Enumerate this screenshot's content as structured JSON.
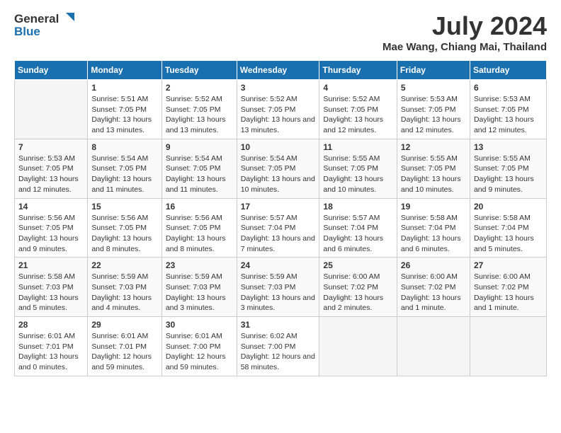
{
  "header": {
    "logo_general": "General",
    "logo_blue": "Blue",
    "month_year": "July 2024",
    "location": "Mae Wang, Chiang Mai, Thailand"
  },
  "calendar": {
    "weekdays": [
      "Sunday",
      "Monday",
      "Tuesday",
      "Wednesday",
      "Thursday",
      "Friday",
      "Saturday"
    ],
    "weeks": [
      [
        {
          "day": "",
          "sunrise": "",
          "sunset": "",
          "daylight": ""
        },
        {
          "day": "1",
          "sunrise": "Sunrise: 5:51 AM",
          "sunset": "Sunset: 7:05 PM",
          "daylight": "Daylight: 13 hours and 13 minutes."
        },
        {
          "day": "2",
          "sunrise": "Sunrise: 5:52 AM",
          "sunset": "Sunset: 7:05 PM",
          "daylight": "Daylight: 13 hours and 13 minutes."
        },
        {
          "day": "3",
          "sunrise": "Sunrise: 5:52 AM",
          "sunset": "Sunset: 7:05 PM",
          "daylight": "Daylight: 13 hours and 13 minutes."
        },
        {
          "day": "4",
          "sunrise": "Sunrise: 5:52 AM",
          "sunset": "Sunset: 7:05 PM",
          "daylight": "Daylight: 13 hours and 12 minutes."
        },
        {
          "day": "5",
          "sunrise": "Sunrise: 5:53 AM",
          "sunset": "Sunset: 7:05 PM",
          "daylight": "Daylight: 13 hours and 12 minutes."
        },
        {
          "day": "6",
          "sunrise": "Sunrise: 5:53 AM",
          "sunset": "Sunset: 7:05 PM",
          "daylight": "Daylight: 13 hours and 12 minutes."
        }
      ],
      [
        {
          "day": "7",
          "sunrise": "Sunrise: 5:53 AM",
          "sunset": "Sunset: 7:05 PM",
          "daylight": "Daylight: 13 hours and 12 minutes."
        },
        {
          "day": "8",
          "sunrise": "Sunrise: 5:54 AM",
          "sunset": "Sunset: 7:05 PM",
          "daylight": "Daylight: 13 hours and 11 minutes."
        },
        {
          "day": "9",
          "sunrise": "Sunrise: 5:54 AM",
          "sunset": "Sunset: 7:05 PM",
          "daylight": "Daylight: 13 hours and 11 minutes."
        },
        {
          "day": "10",
          "sunrise": "Sunrise: 5:54 AM",
          "sunset": "Sunset: 7:05 PM",
          "daylight": "Daylight: 13 hours and 10 minutes."
        },
        {
          "day": "11",
          "sunrise": "Sunrise: 5:55 AM",
          "sunset": "Sunset: 7:05 PM",
          "daylight": "Daylight: 13 hours and 10 minutes."
        },
        {
          "day": "12",
          "sunrise": "Sunrise: 5:55 AM",
          "sunset": "Sunset: 7:05 PM",
          "daylight": "Daylight: 13 hours and 10 minutes."
        },
        {
          "day": "13",
          "sunrise": "Sunrise: 5:55 AM",
          "sunset": "Sunset: 7:05 PM",
          "daylight": "Daylight: 13 hours and 9 minutes."
        }
      ],
      [
        {
          "day": "14",
          "sunrise": "Sunrise: 5:56 AM",
          "sunset": "Sunset: 7:05 PM",
          "daylight": "Daylight: 13 hours and 9 minutes."
        },
        {
          "day": "15",
          "sunrise": "Sunrise: 5:56 AM",
          "sunset": "Sunset: 7:05 PM",
          "daylight": "Daylight: 13 hours and 8 minutes."
        },
        {
          "day": "16",
          "sunrise": "Sunrise: 5:56 AM",
          "sunset": "Sunset: 7:05 PM",
          "daylight": "Daylight: 13 hours and 8 minutes."
        },
        {
          "day": "17",
          "sunrise": "Sunrise: 5:57 AM",
          "sunset": "Sunset: 7:04 PM",
          "daylight": "Daylight: 13 hours and 7 minutes."
        },
        {
          "day": "18",
          "sunrise": "Sunrise: 5:57 AM",
          "sunset": "Sunset: 7:04 PM",
          "daylight": "Daylight: 13 hours and 6 minutes."
        },
        {
          "day": "19",
          "sunrise": "Sunrise: 5:58 AM",
          "sunset": "Sunset: 7:04 PM",
          "daylight": "Daylight: 13 hours and 6 minutes."
        },
        {
          "day": "20",
          "sunrise": "Sunrise: 5:58 AM",
          "sunset": "Sunset: 7:04 PM",
          "daylight": "Daylight: 13 hours and 5 minutes."
        }
      ],
      [
        {
          "day": "21",
          "sunrise": "Sunrise: 5:58 AM",
          "sunset": "Sunset: 7:03 PM",
          "daylight": "Daylight: 13 hours and 5 minutes."
        },
        {
          "day": "22",
          "sunrise": "Sunrise: 5:59 AM",
          "sunset": "Sunset: 7:03 PM",
          "daylight": "Daylight: 13 hours and 4 minutes."
        },
        {
          "day": "23",
          "sunrise": "Sunrise: 5:59 AM",
          "sunset": "Sunset: 7:03 PM",
          "daylight": "Daylight: 13 hours and 3 minutes."
        },
        {
          "day": "24",
          "sunrise": "Sunrise: 5:59 AM",
          "sunset": "Sunset: 7:03 PM",
          "daylight": "Daylight: 13 hours and 3 minutes."
        },
        {
          "day": "25",
          "sunrise": "Sunrise: 6:00 AM",
          "sunset": "Sunset: 7:02 PM",
          "daylight": "Daylight: 13 hours and 2 minutes."
        },
        {
          "day": "26",
          "sunrise": "Sunrise: 6:00 AM",
          "sunset": "Sunset: 7:02 PM",
          "daylight": "Daylight: 13 hours and 1 minute."
        },
        {
          "day": "27",
          "sunrise": "Sunrise: 6:00 AM",
          "sunset": "Sunset: 7:02 PM",
          "daylight": "Daylight: 13 hours and 1 minute."
        }
      ],
      [
        {
          "day": "28",
          "sunrise": "Sunrise: 6:01 AM",
          "sunset": "Sunset: 7:01 PM",
          "daylight": "Daylight: 13 hours and 0 minutes."
        },
        {
          "day": "29",
          "sunrise": "Sunrise: 6:01 AM",
          "sunset": "Sunset: 7:01 PM",
          "daylight": "Daylight: 12 hours and 59 minutes."
        },
        {
          "day": "30",
          "sunrise": "Sunrise: 6:01 AM",
          "sunset": "Sunset: 7:00 PM",
          "daylight": "Daylight: 12 hours and 59 minutes."
        },
        {
          "day": "31",
          "sunrise": "Sunrise: 6:02 AM",
          "sunset": "Sunset: 7:00 PM",
          "daylight": "Daylight: 12 hours and 58 minutes."
        },
        {
          "day": "",
          "sunrise": "",
          "sunset": "",
          "daylight": ""
        },
        {
          "day": "",
          "sunrise": "",
          "sunset": "",
          "daylight": ""
        },
        {
          "day": "",
          "sunrise": "",
          "sunset": "",
          "daylight": ""
        }
      ]
    ]
  }
}
